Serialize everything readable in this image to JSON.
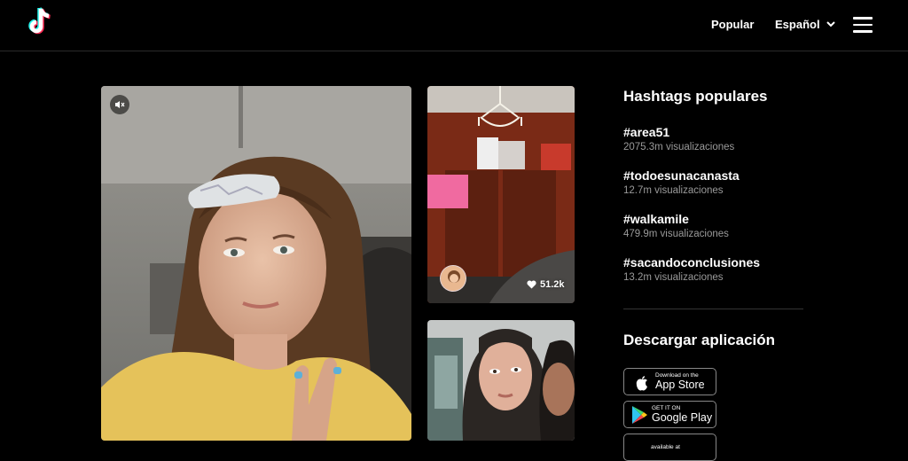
{
  "header": {
    "logo_icon": "tiktok-logo-icon",
    "nav_popular": "Popular",
    "language": "Español",
    "menu_icon": "hamburger-menu-icon"
  },
  "main_video": {
    "mute_icon": "muted-speaker-icon"
  },
  "thumbnails": [
    {
      "likes": "51.2k",
      "like_icon": "heart-icon"
    },
    {}
  ],
  "sidebar": {
    "hashtags_title": "Hashtags populares",
    "hashtags": [
      {
        "name": "#area51",
        "views": "2075.3m visualizaciones"
      },
      {
        "name": "#todoesunacanasta",
        "views": "12.7m visualizaciones"
      },
      {
        "name": "#walkamile",
        "views": "479.9m visualizaciones"
      },
      {
        "name": "#sacandoconclusiones",
        "views": "13.2m visualizaciones"
      }
    ],
    "download_title": "Descargar aplicación",
    "app_store": {
      "small": "Download on the",
      "big": "App Store"
    },
    "google_play": {
      "small": "GET IT ON",
      "big": "Google Play"
    },
    "amazon": {
      "small": "available at"
    }
  },
  "colors": {
    "background": "#000000",
    "muted_text": "#9a9a9a",
    "tiktok_cyan": "#25F4EE",
    "tiktok_red": "#FE2C55"
  }
}
